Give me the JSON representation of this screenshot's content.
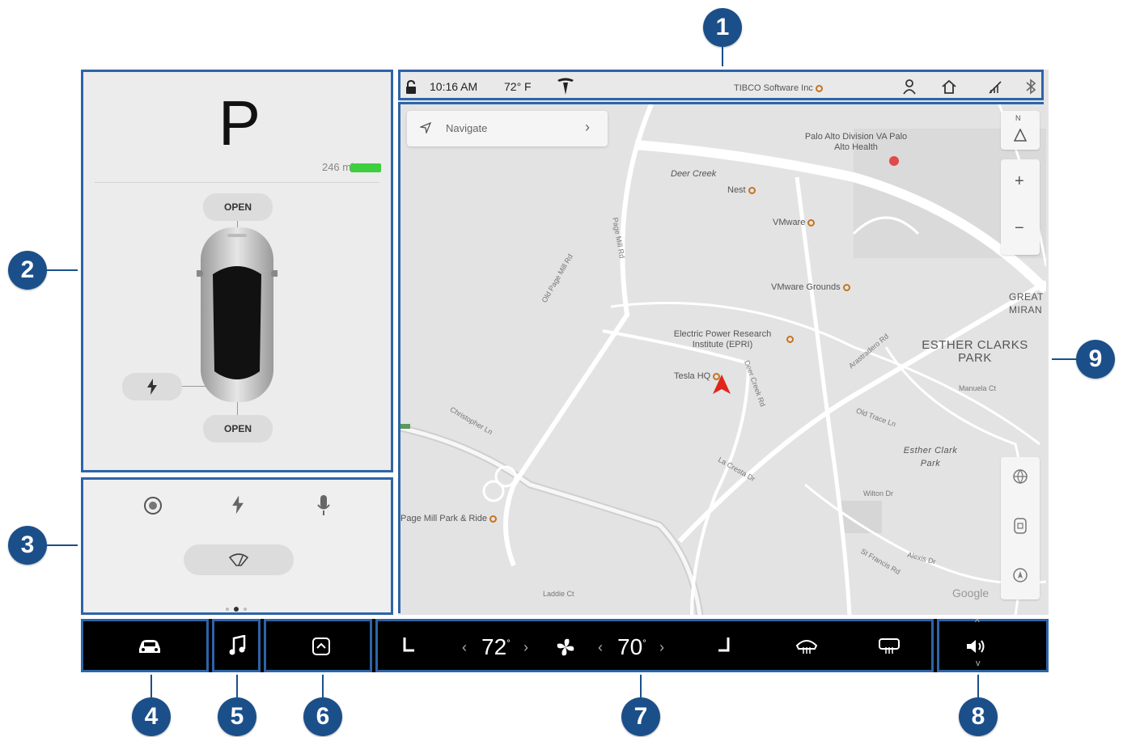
{
  "callouts": [
    "1",
    "2",
    "3",
    "4",
    "5",
    "6",
    "7",
    "8",
    "9"
  ],
  "car": {
    "gear": "P",
    "range": "246 mi",
    "frunk_label": "OPEN",
    "trunk_label": "OPEN",
    "battery_color": "#3ecf3e"
  },
  "status": {
    "time": "10:16 AM",
    "temperature": "72° F"
  },
  "navigate": {
    "label": "Navigate",
    "chevron": "›"
  },
  "map": {
    "compass": "N",
    "zoom_in": "+",
    "zoom_out": "−",
    "pois": [
      "TIBCO Software Inc",
      "Palo Alto Division VA Palo Alto Health",
      "Deer Creek",
      "Nest",
      "VMware",
      "VMware Grounds",
      "Electric Power Research Institute (EPRI)",
      "Tesla HQ",
      "Page Mill Park & Ride"
    ],
    "areas": [
      "ESTHER CLARKS PARK",
      "Esther Clark Park",
      "GREAT MIRAN"
    ],
    "roads": [
      "Page Mill Rd",
      "Old Page Mill Rd",
      "Deer Creek Rd",
      "Arastradero Rd",
      "Old Trace Ln",
      "La Cresta Dr",
      "St Francis Rd",
      "Manuela Ct",
      "Christopher Ln",
      "Alexis Dr",
      "Laddie Ct",
      "Wilton Dr"
    ],
    "attribution": "Google"
  },
  "climate": {
    "driver_temp": "72",
    "passenger_temp": "70",
    "degree": "°",
    "left": "‹",
    "right": "›"
  },
  "volume": {
    "up": "^",
    "down": "v"
  },
  "colors": {
    "accent": "#2d64a8",
    "callout": "#1b4f8a",
    "nav_arrow": "#e1251b"
  }
}
